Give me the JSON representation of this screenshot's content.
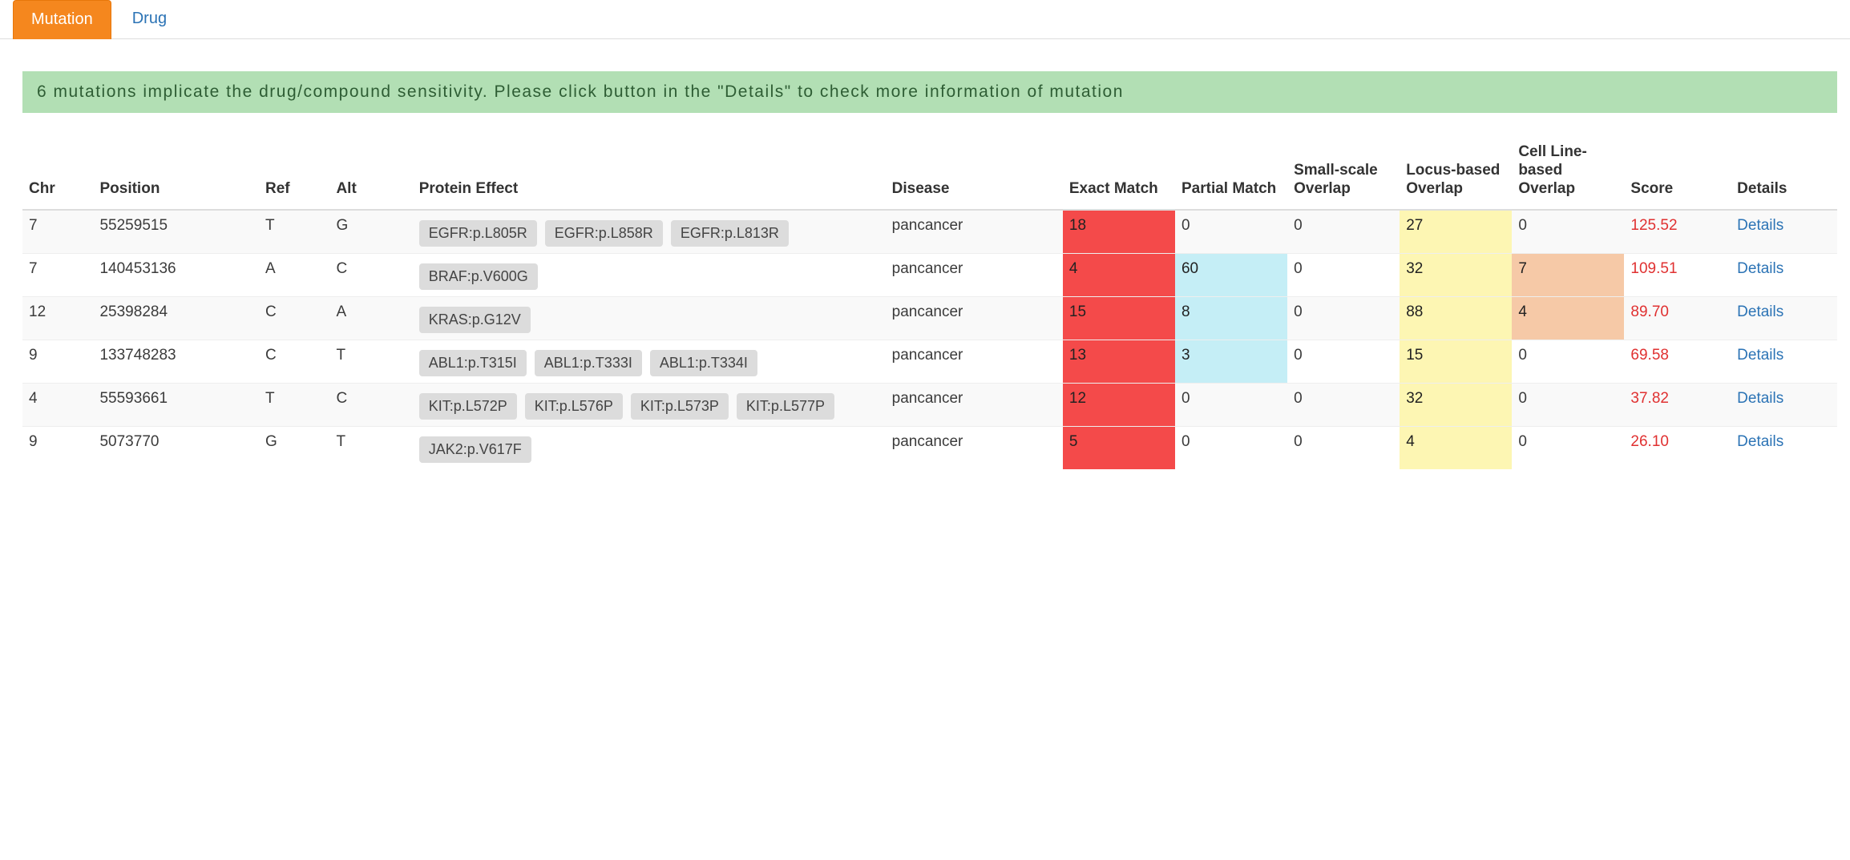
{
  "tabs": {
    "mutation": "Mutation",
    "drug": "Drug"
  },
  "banner": "6 mutations implicate the drug/compound sensitivity. Please click button in the \"Details\" to check more information of mutation",
  "headers": {
    "chr": "Chr",
    "position": "Position",
    "ref": "Ref",
    "alt": "Alt",
    "protein": "Protein Effect",
    "disease": "Disease",
    "exact": "Exact Match",
    "partial": "Partial Match",
    "small": "Small-scale Overlap",
    "locus": "Locus-based Overlap",
    "cell": "Cell Line-based Overlap",
    "score": "Score",
    "details": "Details"
  },
  "detailsLabel": "Details",
  "rows": [
    {
      "chr": "7",
      "position": "55259515",
      "ref": "T",
      "alt": "G",
      "protein": [
        "EGFR:p.L805R",
        "EGFR:p.L858R",
        "EGFR:p.L813R"
      ],
      "disease": "pancancer",
      "exact": "18",
      "partial": "0",
      "small": "0",
      "locus": "27",
      "cell": "0",
      "score": "125.52",
      "hl": {
        "exact": "red",
        "locus": "yellow"
      }
    },
    {
      "chr": "7",
      "position": "140453136",
      "ref": "A",
      "alt": "C",
      "protein": [
        "BRAF:p.V600G"
      ],
      "disease": "pancancer",
      "exact": "4",
      "partial": "60",
      "small": "0",
      "locus": "32",
      "cell": "7",
      "score": "109.51",
      "hl": {
        "exact": "red",
        "partial": "blue",
        "locus": "yellow",
        "cell": "peach"
      }
    },
    {
      "chr": "12",
      "position": "25398284",
      "ref": "C",
      "alt": "A",
      "protein": [
        "KRAS:p.G12V"
      ],
      "disease": "pancancer",
      "exact": "15",
      "partial": "8",
      "small": "0",
      "locus": "88",
      "cell": "4",
      "score": "89.70",
      "hl": {
        "exact": "red",
        "partial": "blue",
        "locus": "yellow",
        "cell": "peach"
      }
    },
    {
      "chr": "9",
      "position": "133748283",
      "ref": "C",
      "alt": "T",
      "protein": [
        "ABL1:p.T315I",
        "ABL1:p.T333I",
        "ABL1:p.T334I"
      ],
      "disease": "pancancer",
      "exact": "13",
      "partial": "3",
      "small": "0",
      "locus": "15",
      "cell": "0",
      "score": "69.58",
      "hl": {
        "exact": "red",
        "partial": "blue",
        "locus": "yellow"
      }
    },
    {
      "chr": "4",
      "position": "55593661",
      "ref": "T",
      "alt": "C",
      "protein": [
        "KIT:p.L572P",
        "KIT:p.L576P",
        "KIT:p.L573P",
        "KIT:p.L577P"
      ],
      "disease": "pancancer",
      "exact": "12",
      "partial": "0",
      "small": "0",
      "locus": "32",
      "cell": "0",
      "score": "37.82",
      "hl": {
        "exact": "red",
        "locus": "yellow"
      }
    },
    {
      "chr": "9",
      "position": "5073770",
      "ref": "G",
      "alt": "T",
      "protein": [
        "JAK2:p.V617F"
      ],
      "disease": "pancancer",
      "exact": "5",
      "partial": "0",
      "small": "0",
      "locus": "4",
      "cell": "0",
      "score": "26.10",
      "hl": {
        "exact": "red",
        "locus": "yellow"
      }
    }
  ]
}
